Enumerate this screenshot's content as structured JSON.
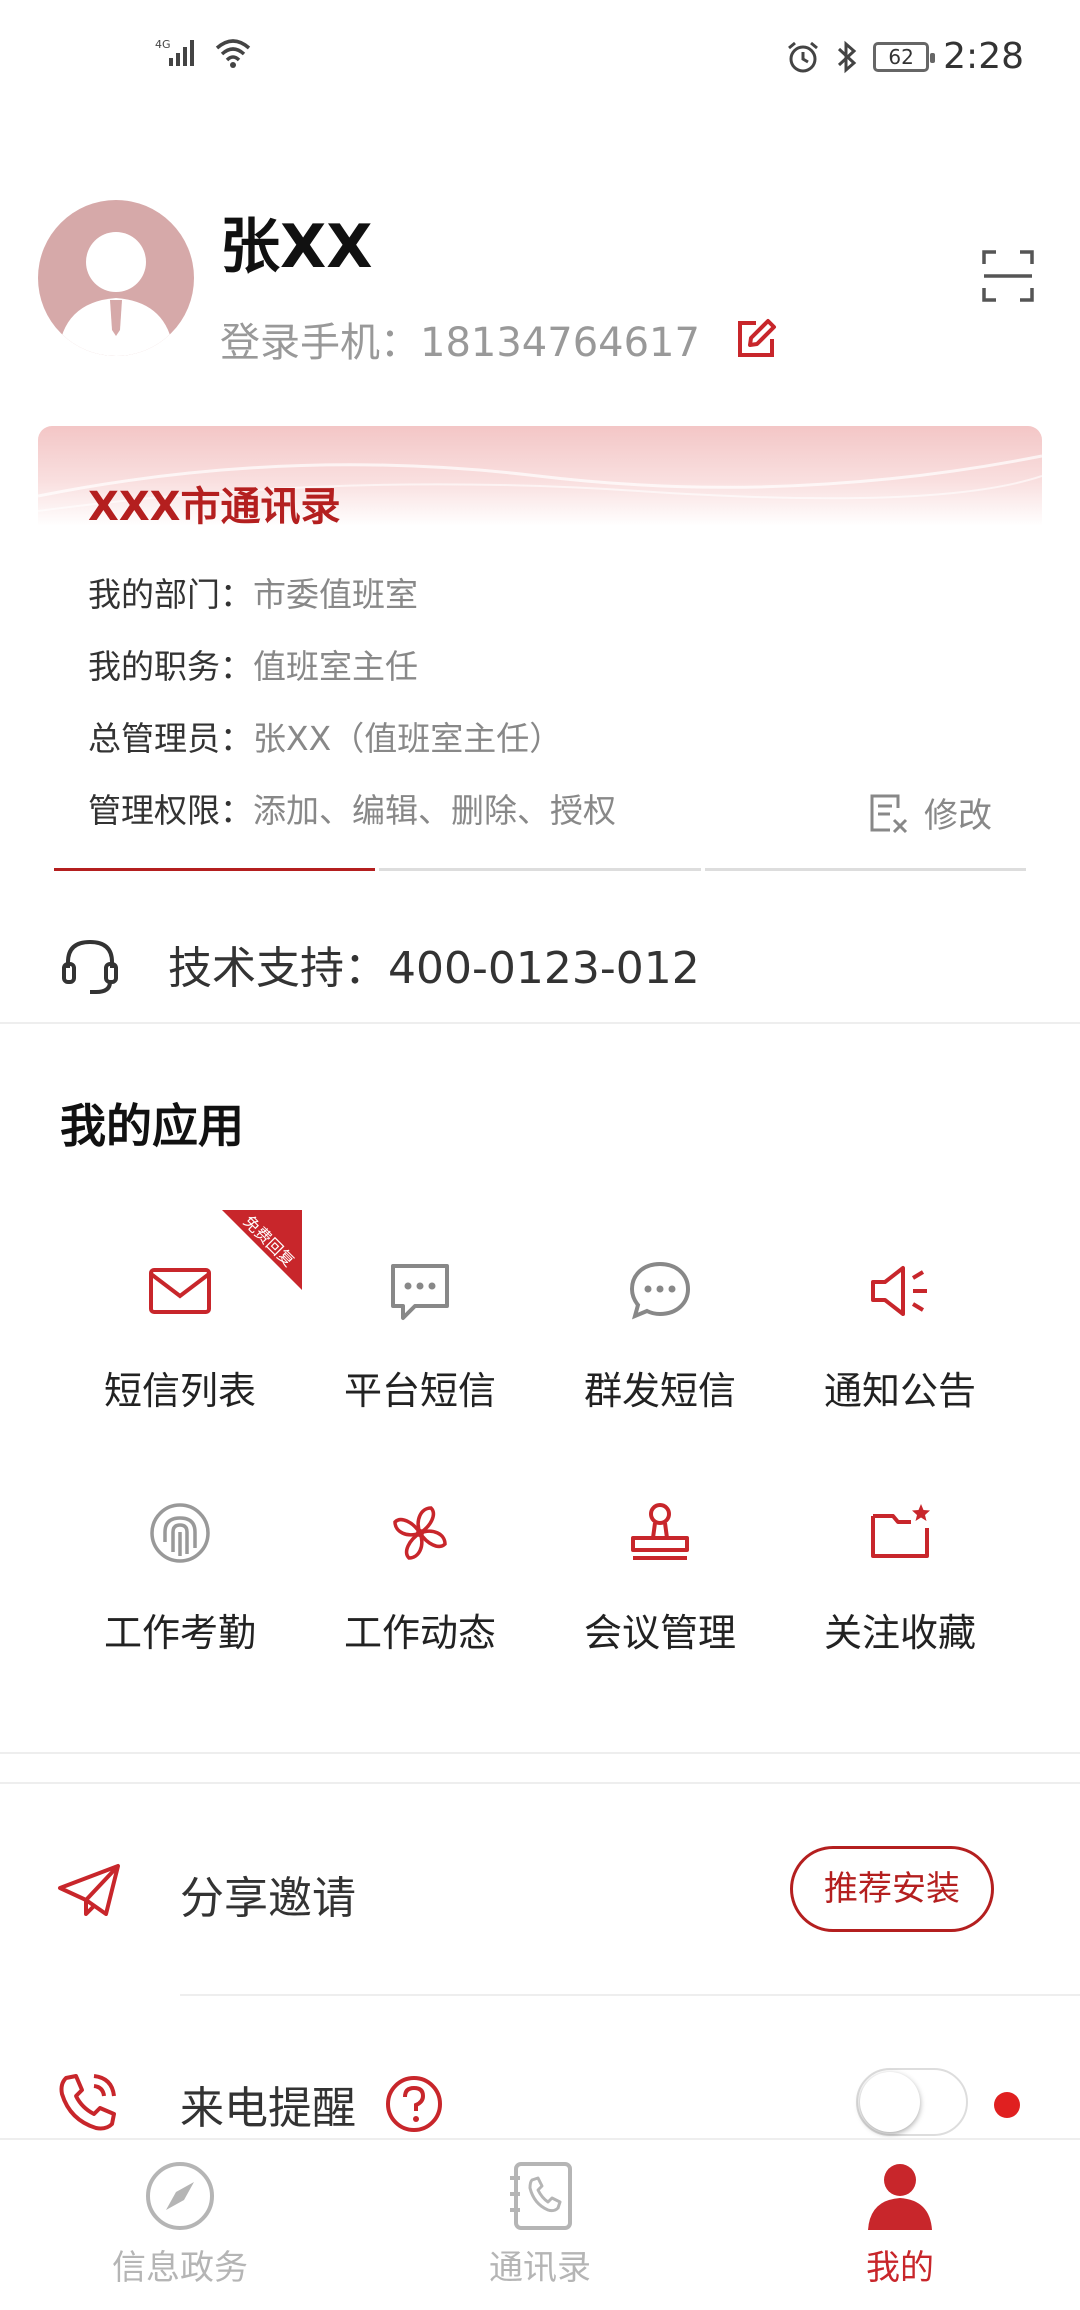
{
  "status": {
    "network": "4G",
    "battery": "62",
    "time": "2:28"
  },
  "profile": {
    "name": "张XX",
    "phone_label": "登录手机：18134764617"
  },
  "card": {
    "title": "XXX市通讯录",
    "rows": [
      {
        "key": "我的部门：",
        "value": "市委值班室"
      },
      {
        "key": "我的职务：",
        "value": "值班室主任"
      },
      {
        "key": "总管理员：",
        "value": "张XX（值班室主任）"
      },
      {
        "key": "管理权限：",
        "value": "添加、编辑、删除、授权"
      }
    ],
    "modify_label": "修改"
  },
  "support": {
    "text": "技术支持：400-0123-012"
  },
  "apps": {
    "title": "我的应用",
    "badge": "免费回复",
    "items": [
      {
        "label": "短信列表",
        "icon": "envelope-icon"
      },
      {
        "label": "平台短信",
        "icon": "chat-bubble-icon"
      },
      {
        "label": "群发短信",
        "icon": "round-chat-icon"
      },
      {
        "label": "通知公告",
        "icon": "speaker-icon"
      },
      {
        "label": "工作考勤",
        "icon": "fingerprint-icon"
      },
      {
        "label": "工作动态",
        "icon": "pinwheel-icon"
      },
      {
        "label": "会议管理",
        "icon": "stamp-icon"
      },
      {
        "label": "关注收藏",
        "icon": "folder-star-icon"
      }
    ]
  },
  "list": {
    "share_label": "分享邀请",
    "share_button": "推荐安装",
    "call_label": "来电提醒",
    "call_toggle_on": false
  },
  "nav": {
    "items": [
      {
        "label": "信息政务",
        "icon": "compass-icon",
        "active": false
      },
      {
        "label": "通讯录",
        "icon": "contacts-phone-icon",
        "active": false
      },
      {
        "label": "我的",
        "icon": "person-icon",
        "active": true
      }
    ]
  },
  "colors": {
    "accent": "#b41f1f",
    "muted": "#999999",
    "inactive_nav": "#b5b5b5"
  }
}
